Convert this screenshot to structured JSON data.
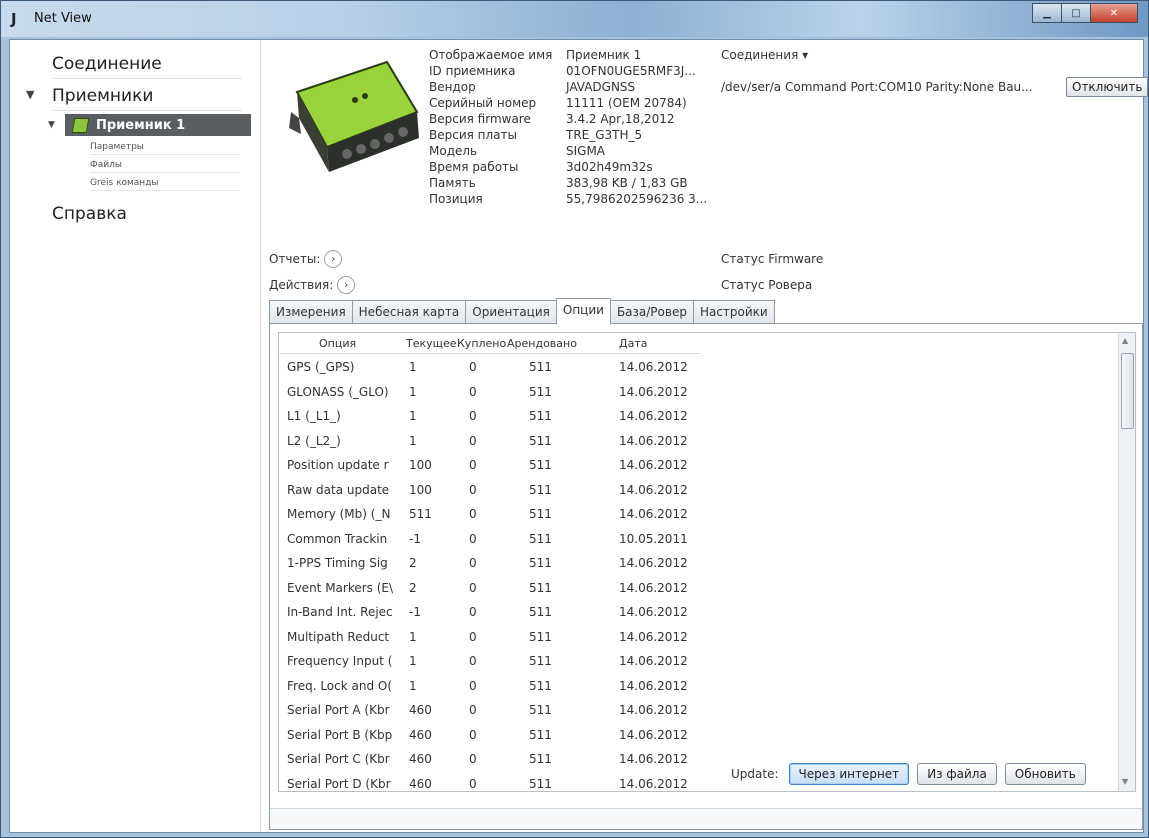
{
  "window": {
    "title": "Net View"
  },
  "sidebar": {
    "connection": "Соединение",
    "receivers": "Приемники",
    "receiver_item": "Приемник 1",
    "sub_items": [
      "Параметры",
      "Файлы",
      "Greis команды"
    ],
    "help": "Справка"
  },
  "info": {
    "labels": [
      "Отображаемое имя",
      "ID приемника",
      "Вендор",
      "Серийный номер",
      "Версия firmware",
      "Версия платы",
      "Модель",
      "Время работы",
      "Память",
      "Позиция"
    ],
    "values": [
      "Приемник 1",
      "01OFN0UGE5RMF3J...",
      "JAVADGNSS",
      "11111 (OEM 20784)",
      "3.4.2 Apr,18,2012",
      "TRE_G3TH_5",
      "SIGMA",
      "3d02h49m32s",
      "383,98 KB / 1,83 GB",
      "55,7986202596236 3..."
    ]
  },
  "connections": {
    "header": "Соединения ▾",
    "line": "/dev/ser/a Command Port:COM10 Parity:None Bau...",
    "disconnect": "Отключить"
  },
  "reports_label": "Отчеты:",
  "actions_label": "Действия:",
  "status_firmware": "Статус Firmware",
  "status_rover": "Статус  Ровера",
  "tabs": [
    "Измерения",
    "Небесная карта",
    "Ориентация",
    "Опции",
    "База/Ровер",
    "Настройки"
  ],
  "active_tab": "Опции",
  "options_table": {
    "headers": [
      "Опция",
      "Текущее",
      "Куплено",
      "Арендовано",
      "Дата"
    ],
    "rows": [
      [
        "GPS (_GPS)",
        "1",
        "0",
        "511",
        "14.06.2012"
      ],
      [
        "GLONASS (_GLO)",
        "1",
        "0",
        "511",
        "14.06.2012"
      ],
      [
        "L1 (_L1_)",
        "1",
        "0",
        "511",
        "14.06.2012"
      ],
      [
        "L2 (_L2_)",
        "1",
        "0",
        "511",
        "14.06.2012"
      ],
      [
        "Position update r",
        "100",
        "0",
        "511",
        "14.06.2012"
      ],
      [
        "Raw data update",
        "100",
        "0",
        "511",
        "14.06.2012"
      ],
      [
        "Memory (Mb) (_N",
        "511",
        "0",
        "511",
        "14.06.2012"
      ],
      [
        "Common Trackin",
        "-1",
        "0",
        "511",
        "10.05.2011"
      ],
      [
        "1-PPS Timing Sig",
        "2",
        "0",
        "511",
        "14.06.2012"
      ],
      [
        "Event Markers (E\\",
        "2",
        "0",
        "511",
        "14.06.2012"
      ],
      [
        "In-Band Int. Rejec",
        "-1",
        "0",
        "511",
        "14.06.2012"
      ],
      [
        "Multipath Reduct",
        "1",
        "0",
        "511",
        "14.06.2012"
      ],
      [
        "Frequency Input (",
        "1",
        "0",
        "511",
        "14.06.2012"
      ],
      [
        "Freq. Lock and O(",
        "1",
        "0",
        "511",
        "14.06.2012"
      ],
      [
        "Serial Port A (Kbr",
        "460",
        "0",
        "511",
        "14.06.2012"
      ],
      [
        "Serial Port B (Kbp",
        "460",
        "0",
        "511",
        "14.06.2012"
      ],
      [
        "Serial Port C (Kbr",
        "460",
        "0",
        "511",
        "14.06.2012"
      ],
      [
        "Serial Port D (Kbr",
        "460",
        "0",
        "511",
        "14.06.2012"
      ]
    ]
  },
  "update": {
    "label": "Update:",
    "internet": "Через интернет",
    "file": "Из файла",
    "refresh": "Обновить"
  }
}
